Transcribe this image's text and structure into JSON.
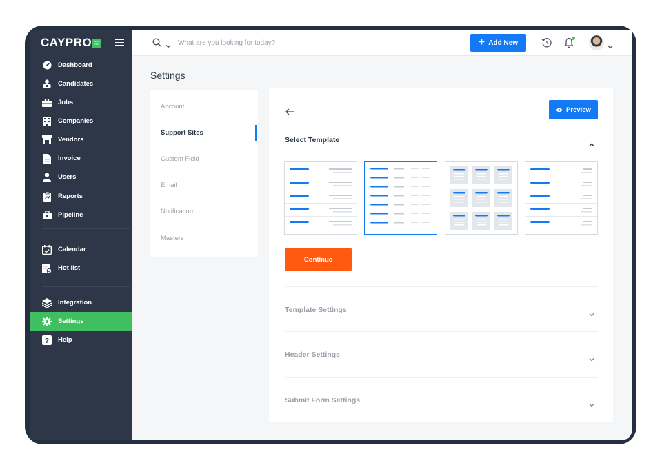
{
  "brand": {
    "name": "CAYPRO",
    "badge": "SAAS CRM"
  },
  "sidebar": {
    "items": [
      {
        "label": "Dashboard",
        "icon": "dashboard-icon"
      },
      {
        "label": "Candidates",
        "icon": "candidates-icon"
      },
      {
        "label": "Jobs",
        "icon": "briefcase-icon"
      },
      {
        "label": "Companies",
        "icon": "building-icon"
      },
      {
        "label": "Vendors",
        "icon": "store-icon"
      },
      {
        "label": "Invoice",
        "icon": "document-icon"
      },
      {
        "label": "Users",
        "icon": "user-icon"
      },
      {
        "label": "Reports",
        "icon": "report-icon"
      },
      {
        "label": "Pipeline",
        "icon": "pipeline-icon"
      },
      {
        "label": "Calendar",
        "icon": "calendar-icon"
      },
      {
        "label": "Hot list",
        "icon": "hotlist-icon"
      },
      {
        "label": "Integration",
        "icon": "layers-icon"
      },
      {
        "label": "Settings",
        "icon": "gear-icon",
        "active": true
      },
      {
        "label": "Help",
        "icon": "help-icon"
      }
    ]
  },
  "topbar": {
    "search_placeholder": "What are you looking for today?",
    "add_new_label": "Add New"
  },
  "page": {
    "title": "Settings"
  },
  "settings_menu": {
    "items": [
      "Account",
      "Support Sites",
      "Custom Field",
      "Email",
      "Notification",
      "Masters"
    ],
    "active_index": 1
  },
  "panel": {
    "preview_label": "Preview",
    "select_template_title": "Select Template",
    "selected_template_index": 1,
    "continue_label": "Continue",
    "sections": [
      "Template Settings",
      "Header Settings",
      "Submit Form Settings"
    ]
  },
  "colors": {
    "accent": "#1479f5",
    "active_nav": "#3fbf60",
    "cta": "#ff5a10",
    "sidebar_bg": "#2d3748"
  }
}
